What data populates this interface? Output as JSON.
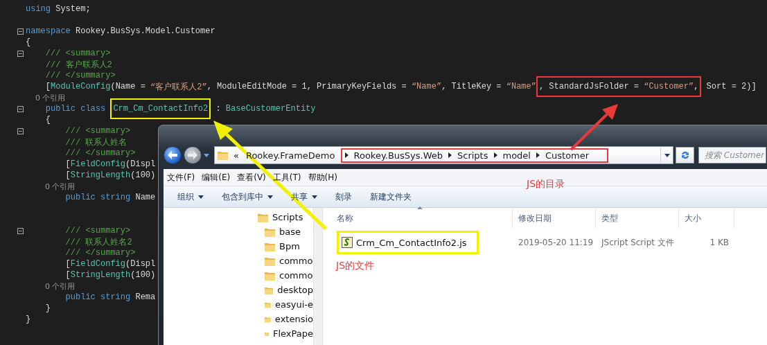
{
  "code": {
    "lines": [
      {
        "fold": false,
        "segments": [
          {
            "kind": "keyword",
            "text": "using"
          },
          {
            "kind": "plain",
            "text": " System;"
          }
        ]
      },
      {
        "fold": false
      },
      {
        "fold": true,
        "segments": [
          {
            "kind": "keyword",
            "text": "namespace"
          },
          {
            "kind": "plain",
            "text": " Rookey.BusSys.Model.Customer"
          }
        ]
      },
      {
        "fold": false,
        "segments": [
          {
            "kind": "plain",
            "text": "{"
          }
        ]
      },
      {
        "fold": true,
        "segments": [
          {
            "kind": "comment",
            "text": "    /// <summary>"
          }
        ]
      },
      {
        "fold": false,
        "segments": [
          {
            "kind": "comment",
            "text": "    /// 客户联系人2"
          }
        ]
      },
      {
        "fold": false,
        "segments": [
          {
            "kind": "comment",
            "text": "    /// </summary>"
          }
        ]
      },
      {
        "fold": false,
        "segments": [
          {
            "kind": "plain",
            "text": "    ["
          },
          {
            "kind": "type",
            "text": "ModuleConfig"
          },
          {
            "kind": "plain",
            "text": "(Name = "
          },
          {
            "kind": "string",
            "text": "“客户联系人2”"
          },
          {
            "kind": "plain",
            "text": ", ModuleEditMode = 1, PrimaryKeyFields = "
          },
          {
            "kind": "string",
            "text": "“Name”"
          },
          {
            "kind": "plain",
            "text": ", TitleKey = "
          },
          {
            "kind": "string",
            "text": "“Name”"
          },
          {
            "kind": "frame",
            "color": "#e83a3a",
            "children": [
              {
                "kind": "plain",
                "text": ", StandardJsFolder = "
              },
              {
                "kind": "string",
                "text": "“Customer”"
              },
              {
                "kind": "plain",
                "text": ","
              }
            ]
          },
          {
            "kind": "plain",
            "text": " Sort = 2)]"
          }
        ]
      },
      {
        "fold": false,
        "segments": [
          {
            "kind": "codelens",
            "text": "    0 个引用"
          }
        ]
      },
      {
        "fold": true,
        "segments": [
          {
            "kind": "keyword",
            "text": "    public class "
          },
          {
            "kind": "frame",
            "color": "#f2f200",
            "children": [
              {
                "kind": "type",
                "text": "Crm_Cm_ContactInfo2"
              }
            ]
          },
          {
            "kind": "plain",
            "text": " : "
          },
          {
            "kind": "type",
            "text": "BaseCustomerEntity"
          }
        ]
      },
      {
        "fold": false,
        "segments": [
          {
            "kind": "plain",
            "text": "    {"
          }
        ]
      },
      {
        "fold": true,
        "segments": [
          {
            "kind": "comment",
            "text": "        /// <summary>"
          }
        ]
      },
      {
        "fold": false,
        "segments": [
          {
            "kind": "comment",
            "text": "        /// 联系人姓名"
          }
        ]
      },
      {
        "fold": false,
        "segments": [
          {
            "kind": "comment",
            "text": "        /// </summary>"
          }
        ]
      },
      {
        "fold": false,
        "segments": [
          {
            "kind": "plain",
            "text": "        ["
          },
          {
            "kind": "type",
            "text": "FieldConfig"
          },
          {
            "kind": "plain",
            "text": "(Displ"
          }
        ]
      },
      {
        "fold": false,
        "segments": [
          {
            "kind": "plain",
            "text": "        ["
          },
          {
            "kind": "type",
            "text": "StringLength"
          },
          {
            "kind": "plain",
            "text": "(100)"
          }
        ]
      },
      {
        "fold": false,
        "segments": [
          {
            "kind": "codelens",
            "text": "        0 个引用"
          }
        ]
      },
      {
        "fold": false,
        "segments": [
          {
            "kind": "keyword",
            "text": "        public string"
          },
          {
            "kind": "plain",
            "text": " Name"
          }
        ]
      },
      {
        "fold": false
      },
      {
        "fold": false
      },
      {
        "fold": true,
        "segments": [
          {
            "kind": "comment",
            "text": "        /// <summary>"
          }
        ]
      },
      {
        "fold": false,
        "segments": [
          {
            "kind": "comment",
            "text": "        /// 联系人姓名2"
          }
        ]
      },
      {
        "fold": false,
        "segments": [
          {
            "kind": "comment",
            "text": "        /// </summary>"
          }
        ]
      },
      {
        "fold": false,
        "segments": [
          {
            "kind": "plain",
            "text": "        ["
          },
          {
            "kind": "type",
            "text": "FieldConfig"
          },
          {
            "kind": "plain",
            "text": "(Displ"
          }
        ]
      },
      {
        "fold": false,
        "segments": [
          {
            "kind": "plain",
            "text": "        ["
          },
          {
            "kind": "type",
            "text": "StringLength"
          },
          {
            "kind": "plain",
            "text": "(100)"
          }
        ]
      },
      {
        "fold": false,
        "segments": [
          {
            "kind": "codelens",
            "text": "        0 个引用"
          }
        ]
      },
      {
        "fold": false,
        "segments": [
          {
            "kind": "keyword",
            "text": "        public string"
          },
          {
            "kind": "plain",
            "text": " Rema"
          }
        ]
      },
      {
        "fold": false,
        "segments": [
          {
            "kind": "plain",
            "text": "    }"
          }
        ]
      },
      {
        "fold": false,
        "segments": [
          {
            "kind": "plain",
            "text": "}"
          }
        ]
      }
    ]
  },
  "explorer": {
    "breadcrumb": {
      "overflow": "«",
      "crumbs": [
        {
          "text": "Rookey.FrameDemo"
        }
      ],
      "framed_crumbs": {
        "color": "#e83a3a",
        "crumbs": [
          {
            "text": "Rookey.BusSys.Web"
          },
          {
            "text": "Scripts"
          },
          {
            "text": "model"
          },
          {
            "text": "Customer"
          }
        ]
      }
    },
    "search": {
      "placeholder": "搜索 Customer"
    },
    "menu": [
      "文件(F)",
      "编辑(E)",
      "查看(V)",
      "工具(T)",
      "帮助(H)"
    ],
    "toolbar": [
      {
        "label": "组织",
        "dropdown": true
      },
      {
        "label": "包含到库中",
        "dropdown": true
      },
      {
        "label": "共享",
        "dropdown": true
      },
      {
        "label": "刻录",
        "dropdown": false
      },
      {
        "label": "新建文件夹",
        "dropdown": false
      }
    ],
    "nav": {
      "items": [
        {
          "label": "Scripts",
          "children": [
            {
              "label": "base"
            },
            {
              "label": "Bpm"
            },
            {
              "label": "commo"
            },
            {
              "label": "commo"
            },
            {
              "label": "desktop"
            },
            {
              "label": "easyui-e"
            },
            {
              "label": "extensio"
            },
            {
              "label": "FlexPape"
            }
          ]
        }
      ]
    },
    "columns": [
      "名称",
      "修改日期",
      "类型",
      "大小"
    ],
    "files": [
      {
        "name": "Crm_Cm_ContactInfo2.js",
        "modified": "2019-05-20 11:19",
        "type": "JScript Script 文件",
        "size": "1 KB",
        "color": "#f2f200"
      }
    ]
  },
  "annotations": [
    {
      "text": "JS的目录",
      "color": "#e83a3a"
    },
    {
      "text": "JS的文件",
      "color": "#e83a3a"
    }
  ],
  "arrows": [
    {
      "color": "#f2f200"
    },
    {
      "color": "#e83a3a"
    }
  ]
}
